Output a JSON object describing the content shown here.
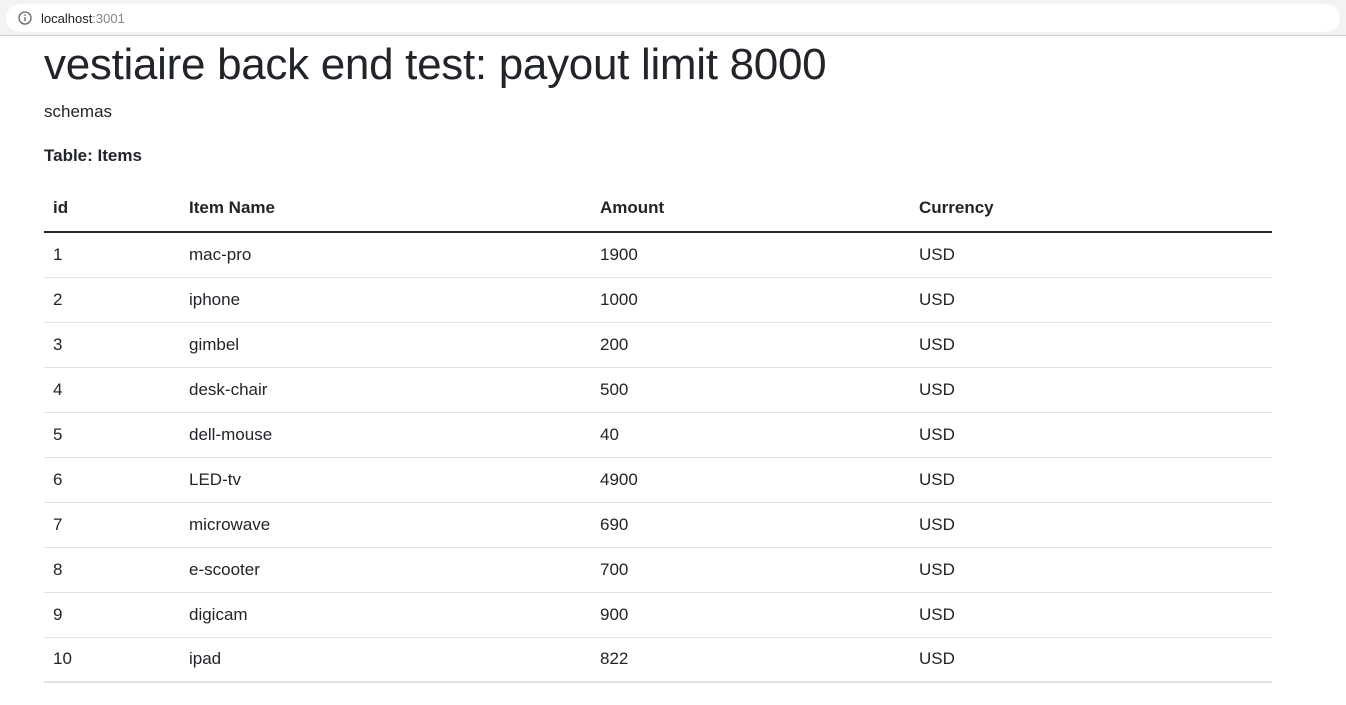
{
  "browser": {
    "url_host": "localhost",
    "url_port": ":3001"
  },
  "page": {
    "title": "vestiaire back end test: payout limit 8000",
    "subtitle": "schemas",
    "table_caption": "Table: Items"
  },
  "table": {
    "columns": [
      "id",
      "Item Name",
      "Amount",
      "Currency"
    ],
    "rows": [
      [
        "1",
        "mac-pro",
        "1900",
        "USD"
      ],
      [
        "2",
        "iphone",
        "1000",
        "USD"
      ],
      [
        "3",
        "gimbel",
        "200",
        "USD"
      ],
      [
        "4",
        "desk-chair",
        "500",
        "USD"
      ],
      [
        "5",
        "dell-mouse",
        "40",
        "USD"
      ],
      [
        "6",
        "LED-tv",
        "4900",
        "USD"
      ],
      [
        "7",
        "microwave",
        "690",
        "USD"
      ],
      [
        "8",
        "e-scooter",
        "700",
        "USD"
      ],
      [
        "9",
        "digicam",
        "900",
        "USD"
      ],
      [
        "10",
        "ipad",
        "822",
        "USD"
      ]
    ]
  }
}
